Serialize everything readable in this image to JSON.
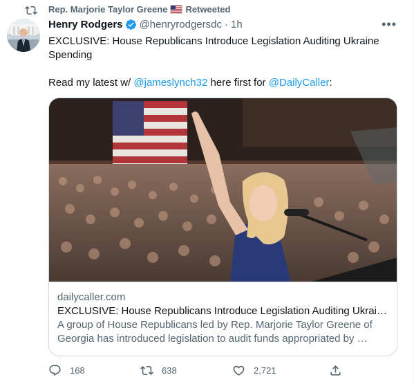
{
  "retweet": {
    "icon": "retweet-icon",
    "by": "Rep. Marjorie Taylor Greene",
    "flag": "us-flag-icon",
    "label": "Retweeted"
  },
  "author": {
    "name": "Henry Rodgers",
    "handle": "@henryrodgersdc",
    "separator": "·",
    "time": "1h",
    "verified_icon": "verified-badge-icon"
  },
  "tweet": {
    "line1": "EXCLUSIVE: House Republicans Introduce Legislation Auditing Ukraine Spending",
    "line2_prefix": "Read my latest w/ ",
    "mention1": "@jameslynch32",
    "line2_middle": " here first for ",
    "mention2": "@DailyCaller",
    "line2_suffix": ":"
  },
  "card": {
    "domain": "dailycaller.com",
    "title": "EXCLUSIVE: House Republicans Introduce Legislation Auditing Ukrain…",
    "description": "A group of House Republicans led by Rep. Marjorie Taylor Greene of Georgia has introduced legislation to audit funds appropriated by …"
  },
  "actions": {
    "replies": "168",
    "retweets": "638",
    "likes": "2,721"
  },
  "colors": {
    "accent": "#1d9bf0",
    "secondary_text": "#536471",
    "border": "#cfd9de"
  }
}
